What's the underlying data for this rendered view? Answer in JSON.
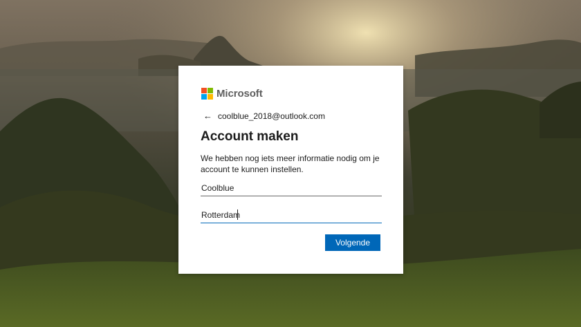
{
  "brand": {
    "name": "Microsoft",
    "logo_colors": [
      "#f25022",
      "#7fba00",
      "#00a4ef",
      "#ffb900"
    ]
  },
  "back": {
    "icon": "back-arrow-icon",
    "email": "coolblue_2018@outlook.com"
  },
  "heading": "Account maken",
  "description": "We hebben nog iets meer informatie nodig om je account te kunnen instellen.",
  "fields": {
    "first_name": {
      "value": "Coolblue"
    },
    "last_name": {
      "value": "Rotterdam"
    }
  },
  "next_button": {
    "label": "Volgende",
    "color": "#0067b8"
  },
  "colors": {
    "accent": "#0067b8",
    "text": "#1b1b1b"
  }
}
